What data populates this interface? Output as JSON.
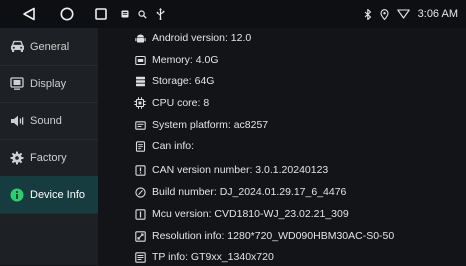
{
  "status_bar": {
    "time": "3:06 AM",
    "nav_icons": [
      "back-triangle-icon",
      "home-circle-icon",
      "recent-apps-square-icon"
    ],
    "left_icons": [
      "notification-icon",
      "search-icon",
      "usb-icon"
    ],
    "right_icons": [
      "bluetooth-icon",
      "location-icon",
      "wifi-icon"
    ]
  },
  "sidebar": {
    "items": [
      {
        "label": "General",
        "icon": "car-icon"
      },
      {
        "label": "Display",
        "icon": "display-icon"
      },
      {
        "label": "Sound",
        "icon": "speaker-icon"
      },
      {
        "label": "Factory",
        "icon": "gear-icon"
      },
      {
        "label": "Device Info",
        "icon": "info-icon",
        "active": true
      }
    ],
    "active_color": "#173c40",
    "info_icon_color": "#2ecc71"
  },
  "info": {
    "rows": [
      {
        "text": "Android version:  12.0",
        "icon": "android-icon"
      },
      {
        "text": "Memory:  4.0G",
        "icon": "memory-icon"
      },
      {
        "text": "Storage:  64G",
        "icon": "storage-icon"
      },
      {
        "text": "CPU core:  8",
        "icon": "cpu-icon"
      },
      {
        "text": "System platform:  ac8257",
        "icon": "platform-icon"
      },
      {
        "text": "Can info:",
        "icon": "document-icon"
      },
      {
        "text": "CAN version number:  3.0.1.20240123",
        "icon": "can-icon"
      },
      {
        "text": "Build number:  DJ_2024.01.29.17_6_4476",
        "icon": "build-icon"
      },
      {
        "text": "Mcu version:  CVD1810-WJ_23.02.21_309",
        "icon": "mcu-icon"
      },
      {
        "text": "Resolution info:  1280*720_WD090HBM30AC-S0-50",
        "icon": "resolution-icon"
      },
      {
        "text": "TP info:  GT9xx_1340x720",
        "icon": "touch-panel-icon"
      }
    ]
  }
}
